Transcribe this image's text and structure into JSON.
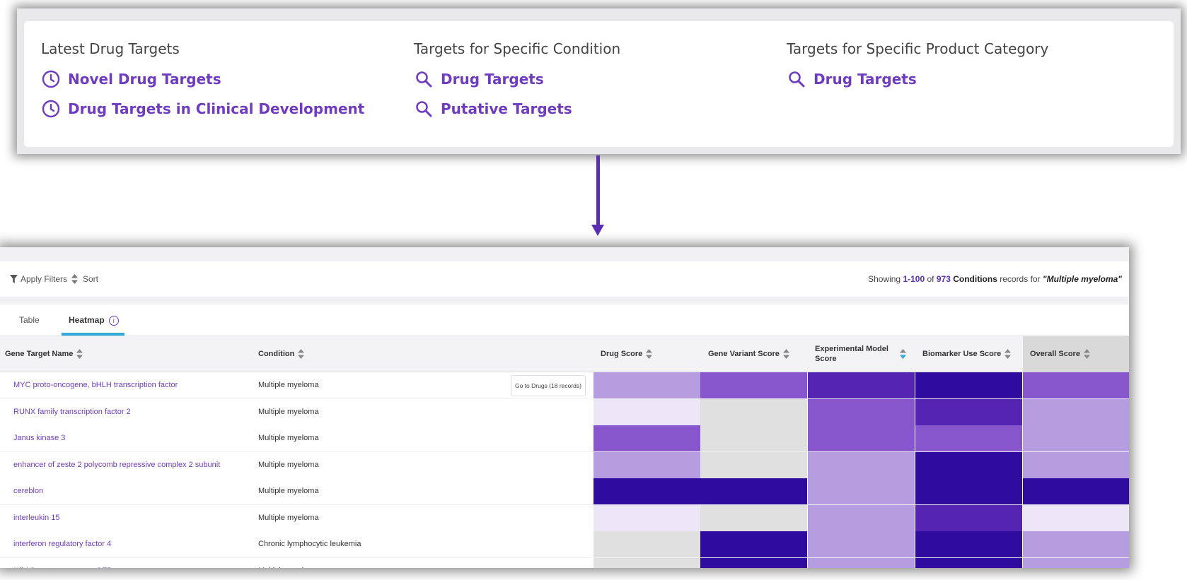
{
  "top": {
    "columns": [
      {
        "heading": "Latest Drug Targets",
        "links": [
          {
            "label": "Novel Drug Targets",
            "icon": "clock-icon"
          },
          {
            "label": "Drug Targets in Clinical Development",
            "icon": "clock-icon"
          }
        ]
      },
      {
        "heading": "Targets for Specific Condition",
        "links": [
          {
            "label": "Drug Targets",
            "icon": "search-icon"
          },
          {
            "label": "Putative Targets",
            "icon": "search-icon"
          }
        ]
      },
      {
        "heading": "Targets for Specific Product Category",
        "links": [
          {
            "label": "Drug Targets",
            "icon": "search-icon"
          }
        ]
      }
    ]
  },
  "toolbar": {
    "apply_filters": "Apply Filters",
    "sort": "Sort",
    "showing_prefix": "Showing",
    "range": "1-100",
    "of": "of",
    "total": "973",
    "entity": "Conditions",
    "records_for": "records for",
    "query": "\"Multiple myeloma\""
  },
  "tabs": {
    "table": "Table",
    "heatmap": "Heatmap",
    "info": "i"
  },
  "grid": {
    "headers": {
      "gene": "Gene Target Name",
      "condition": "Condition",
      "drug_score": "Drug Score",
      "gene_variant_score": "Gene Variant Score",
      "experimental_model_score_1": "Experimental Model",
      "experimental_model_score_2": "Score",
      "biomarker_use_score": "Biomarker Use Score",
      "overall_score": "Overall Score"
    },
    "goto_button": "Go to Drugs (18 records)",
    "colors": {
      "empty": "#e0e0e0",
      "very_low": "#ede6f6",
      "low": "#b59de0",
      "mid": "#8755cc",
      "high": "#5525b2",
      "very_high": "#2f0c9e"
    },
    "rows": [
      {
        "gene": "MYC proto-oncogene, bHLH transcription factor",
        "condition": "Multiple myeloma",
        "scores": [
          "low",
          "mid",
          "high",
          "very_high",
          "mid"
        ]
      },
      {
        "gene": "RUNX family transcription factor 2",
        "condition": "Multiple myeloma",
        "scores": [
          "very_low",
          "empty",
          "mid",
          "high",
          "low"
        ]
      },
      {
        "gene": "Janus kinase 3",
        "condition": "Multiple myeloma",
        "scores": [
          "mid",
          "empty",
          "mid",
          "mid",
          "low"
        ]
      },
      {
        "gene": "enhancer of zeste 2 polycomb repressive complex 2 subunit",
        "condition": "Multiple myeloma",
        "scores": [
          "low",
          "empty",
          "low",
          "very_high",
          "low"
        ]
      },
      {
        "gene": "cereblon",
        "condition": "Multiple myeloma",
        "scores": [
          "very_high",
          "very_high",
          "low",
          "very_high",
          "very_high"
        ]
      },
      {
        "gene": "interleukin 15",
        "condition": "Multiple myeloma",
        "scores": [
          "very_low",
          "empty",
          "low",
          "high",
          "very_low"
        ]
      },
      {
        "gene": "interferon regulatory factor 4",
        "condition": "Chronic lymphocytic leukemia",
        "scores": [
          "empty",
          "very_high",
          "low",
          "very_high",
          "low"
        ]
      },
      {
        "gene": "NRAS proto-oncogene, GTPase",
        "condition": "Multiple myeloma",
        "scores": [
          "empty",
          "very_high",
          "low",
          "very_high",
          "low"
        ]
      }
    ]
  }
}
